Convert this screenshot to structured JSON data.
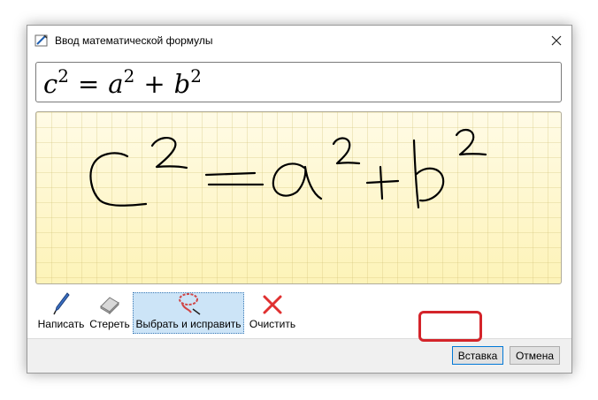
{
  "window": {
    "title": "Ввод математической формулы"
  },
  "formula": {
    "base1": "c",
    "exp1": "2",
    "eq": "=",
    "base2": "a",
    "exp2": "2",
    "plus": "+",
    "base3": "b",
    "exp3": "2"
  },
  "canvas": {
    "content": "handwritten c^2 = a^2 + b^2",
    "ink_color": "#000000"
  },
  "tools": {
    "write": "Написать",
    "erase": "Стереть",
    "select_correct": "Выбрать и исправить",
    "clear": "Очистить",
    "selected": "select_correct"
  },
  "buttons": {
    "insert": "Вставка",
    "cancel": "Отмена"
  },
  "colors": {
    "highlight": "#d4242a",
    "selected_tool_bg": "#cce4f7",
    "clear_icon": "#e03030"
  }
}
